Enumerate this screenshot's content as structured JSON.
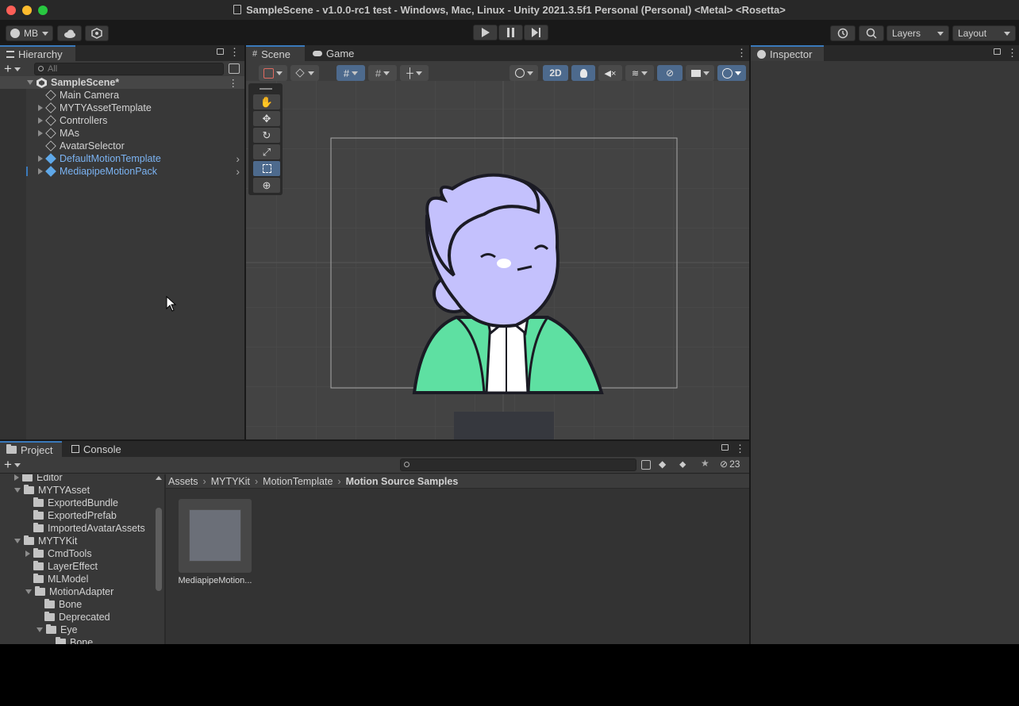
{
  "window": {
    "title": "SampleScene - v1.0.0-rc1 test - Windows, Mac, Linux - Unity 2021.3.5f1 Personal (Personal) <Metal> <Rosetta>"
  },
  "toolbar": {
    "account_label": "MB",
    "layers_label": "Layers",
    "layout_label": "Layout",
    "play_icon": "play-icon",
    "pause_icon": "pause-icon",
    "step_icon": "step-icon"
  },
  "hierarchy": {
    "tab_label": "Hierarchy",
    "search_placeholder": "All",
    "scene_name": "SampleScene*",
    "items": [
      {
        "label": "Main Camera",
        "expandable": false,
        "prefab": false
      },
      {
        "label": "MYTYAssetTemplate",
        "expandable": true,
        "prefab": false
      },
      {
        "label": "Controllers",
        "expandable": true,
        "prefab": false
      },
      {
        "label": "MAs",
        "expandable": true,
        "prefab": false
      },
      {
        "label": "AvatarSelector",
        "expandable": false,
        "prefab": false
      },
      {
        "label": "DefaultMotionTemplate",
        "expandable": true,
        "prefab": true
      },
      {
        "label": "MediapipeMotionPack",
        "expandable": true,
        "prefab": true
      }
    ]
  },
  "scene": {
    "tabs": [
      "Scene",
      "Game"
    ],
    "mode_2d_label": "2D",
    "tools": [
      "hand-tool",
      "move-tool",
      "rotate-tool",
      "scale-tool",
      "rect-tool",
      "transform-tool"
    ]
  },
  "inspector": {
    "tab_label": "Inspector"
  },
  "project": {
    "tabs": [
      "Project",
      "Console"
    ],
    "hidden_count": "23",
    "breadcrumb": [
      "Assets",
      "MYTYKit",
      "MotionTemplate",
      "Motion Source Samples"
    ],
    "tree": [
      {
        "label": "Editor",
        "depth": 1,
        "state": "collapsed"
      },
      {
        "label": "MYTYAsset",
        "depth": 1,
        "state": "expanded"
      },
      {
        "label": "ExportedBundle",
        "depth": 2,
        "state": "leaf"
      },
      {
        "label": "ExportedPrefab",
        "depth": 2,
        "state": "leaf"
      },
      {
        "label": "ImportedAvatarAssets",
        "depth": 2,
        "state": "leaf"
      },
      {
        "label": "MYTYKit",
        "depth": 1,
        "state": "expanded"
      },
      {
        "label": "CmdTools",
        "depth": 2,
        "state": "collapsed"
      },
      {
        "label": "LayerEffect",
        "depth": 2,
        "state": "leaf"
      },
      {
        "label": "MLModel",
        "depth": 2,
        "state": "leaf"
      },
      {
        "label": "MotionAdapter",
        "depth": 2,
        "state": "expanded"
      },
      {
        "label": "Bone",
        "depth": 3,
        "state": "leaf"
      },
      {
        "label": "Deprecated",
        "depth": 3,
        "state": "leaf"
      },
      {
        "label": "Eye",
        "depth": 3,
        "state": "expanded"
      },
      {
        "label": "Bone",
        "depth": 4,
        "state": "leaf"
      }
    ],
    "asset_label": "MediapipeMotion..."
  }
}
